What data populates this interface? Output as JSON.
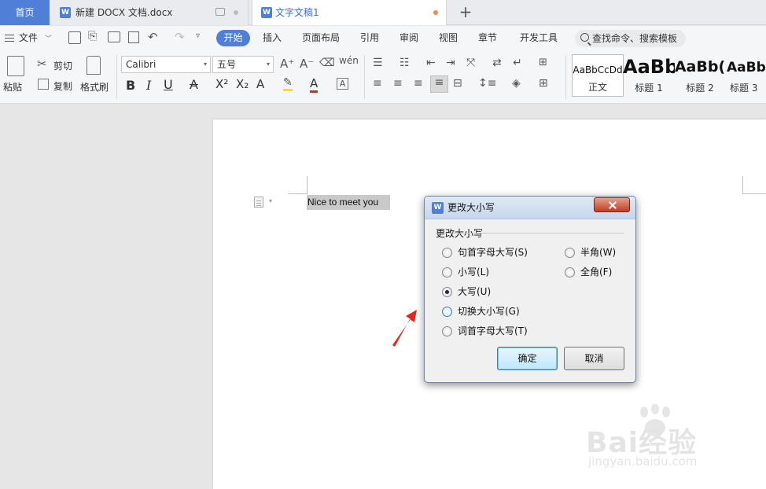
{
  "tabs": {
    "home": "首页",
    "doc1": "新建 DOCX 文档.docx",
    "doc2": "文字文稿1",
    "add": "+"
  },
  "menu": {
    "file": "文件",
    "start": "开始",
    "items": [
      "插入",
      "页面布局",
      "引用",
      "审阅",
      "视图",
      "章节",
      "开发工具"
    ],
    "search_label": "查找命令、搜索模板"
  },
  "ribbon": {
    "paste": "粘贴",
    "cut": "剪切",
    "copy": "复制",
    "format_painter": "格式刷",
    "font_name": "Calibri",
    "font_size": "五号",
    "styles": [
      {
        "sample": "AaBbCcDd",
        "name": "正文"
      },
      {
        "sample": "AaBb",
        "name": "标题 1"
      },
      {
        "sample": "AaBb(",
        "name": "标题 2"
      },
      {
        "sample": "AaBb(",
        "name": "标题 3"
      }
    ]
  },
  "document": {
    "text": "Nice to meet you"
  },
  "dialog": {
    "title": "更改大小写",
    "group_label": "更改大小写",
    "options_left": [
      "句首字母大写(S)",
      "小写(L)",
      "大写(U)",
      "切换大小写(G)",
      "词首字母大写(T)"
    ],
    "options_right": [
      "半角(W)",
      "全角(F)"
    ],
    "selected": "大写(U)",
    "ok": "确定",
    "cancel": "取消"
  },
  "watermark": {
    "brand": "Bai经验",
    "url": "jingyan.baidu.com"
  },
  "colors": {
    "accent": "#4f7fd6",
    "close_red": "#c43b21",
    "arrow_red": "#e8271c"
  }
}
